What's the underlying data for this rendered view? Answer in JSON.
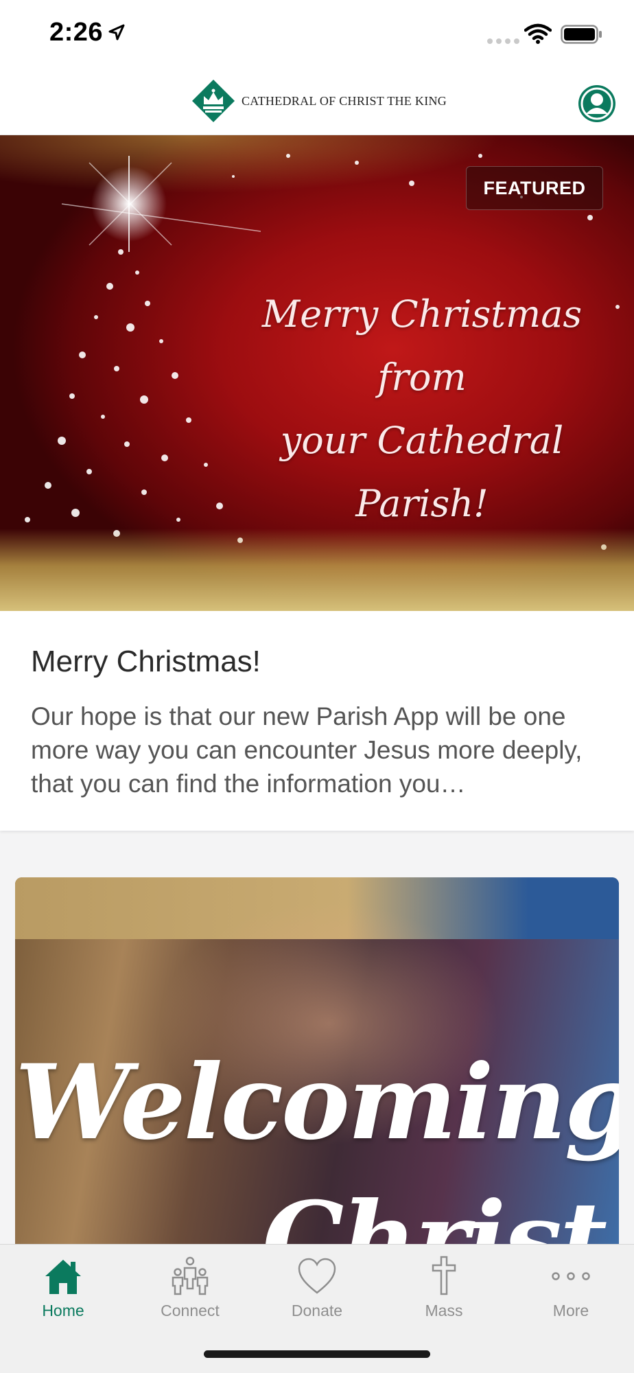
{
  "status_bar": {
    "time": "2:26"
  },
  "header": {
    "logo_text": "CATHEDRAL OF CHRIST THE KING",
    "brand_color": "#0b7a5e"
  },
  "featured": {
    "badge": "FEATURED",
    "hero_lines": [
      "Merry Christmas from",
      "your Cathedral Parish!"
    ],
    "title": "Merry Christmas!",
    "description": "Our hope is that our new Parish App will be one more way you can encounter Jesus more deeply, that you can find the information you…"
  },
  "second_card": {
    "image_lines": [
      "Welcoming",
      "Christ"
    ]
  },
  "tabs": [
    {
      "label": "Home",
      "icon": "home-icon",
      "active": true
    },
    {
      "label": "Connect",
      "icon": "people-icon",
      "active": false
    },
    {
      "label": "Donate",
      "icon": "heart-icon",
      "active": false
    },
    {
      "label": "Mass",
      "icon": "cross-icon",
      "active": false
    },
    {
      "label": "More",
      "icon": "more-icon",
      "active": false
    }
  ]
}
